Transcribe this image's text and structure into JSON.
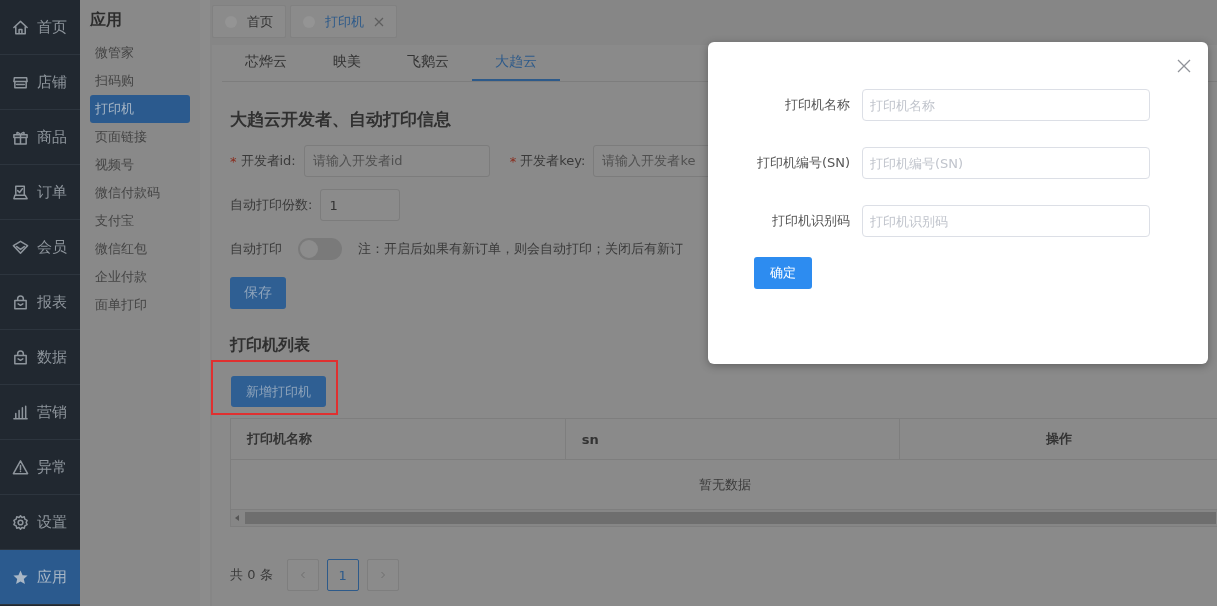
{
  "nav": [
    {
      "label": "首页",
      "kind": "home",
      "selected": false
    },
    {
      "label": "店铺",
      "kind": "store",
      "selected": false
    },
    {
      "label": "商品",
      "kind": "gift",
      "selected": false
    },
    {
      "label": "订单",
      "kind": "order",
      "selected": false
    },
    {
      "label": "会员",
      "kind": "diamond",
      "selected": false
    },
    {
      "label": "报表",
      "kind": "bag",
      "selected": false
    },
    {
      "label": "数据",
      "kind": "bag",
      "selected": false
    },
    {
      "label": "营销",
      "kind": "chart",
      "selected": false
    },
    {
      "label": "异常",
      "kind": "warning",
      "selected": false
    },
    {
      "label": "设置",
      "kind": "gear",
      "selected": false
    },
    {
      "label": "应用",
      "kind": "star",
      "selected": true
    }
  ],
  "submenu": {
    "title": "应用",
    "items": [
      {
        "label": "微管家",
        "selected": false
      },
      {
        "label": "扫码购",
        "selected": false
      },
      {
        "label": "打印机",
        "selected": true
      },
      {
        "label": "页面链接",
        "selected": false
      },
      {
        "label": "视频号",
        "selected": false
      },
      {
        "label": "微信付款码",
        "selected": false
      },
      {
        "label": "支付宝",
        "selected": false
      },
      {
        "label": "微信红包",
        "selected": false
      },
      {
        "label": "企业付款",
        "selected": false
      },
      {
        "label": "面单打印",
        "selected": false
      }
    ]
  },
  "page_tabs": [
    {
      "label": "首页",
      "selected": false,
      "closable": false
    },
    {
      "label": "打印机",
      "selected": true,
      "closable": true
    }
  ],
  "provider_tabs": [
    {
      "label": "芯烨云",
      "selected": false
    },
    {
      "label": "映美",
      "selected": false
    },
    {
      "label": "飞鹅云",
      "selected": false
    },
    {
      "label": "大趋云",
      "selected": true
    }
  ],
  "settings": {
    "title": "大趋云开发者、自动打印信息",
    "credentials": [
      {
        "required_mark": "*",
        "label": "开发者id:",
        "placeholder": "请输入开发者id"
      },
      {
        "required_mark": "*",
        "label": "开发者key:",
        "placeholder": "请输入开发者ke"
      }
    ],
    "copies": {
      "label": "自动打印份数:",
      "value": "1"
    },
    "auto_print": {
      "label": "自动打印",
      "on": false,
      "note": "注：开启后如果有新订单，则会自动打印；关闭后有新订"
    },
    "save_button": "保存"
  },
  "printer_list": {
    "title": "打印机列表",
    "add_button": "新增打印机",
    "highlighted": true,
    "columns": [
      "打印机名称",
      "sn",
      "操作"
    ],
    "empty_text": "暂无数据",
    "pagination": {
      "total": "共 0 条",
      "pages": [
        {
          "label": "1",
          "selected": true
        }
      ]
    }
  },
  "dialog": {
    "fields": [
      {
        "label": "打印机名称",
        "placeholder": "打印机名称"
      },
      {
        "label": "打印机编号(SN)",
        "placeholder": "打印机编号(SN)"
      },
      {
        "label": "打印机识别码",
        "placeholder": "打印机识别码"
      }
    ],
    "confirm_button": "确定"
  }
}
